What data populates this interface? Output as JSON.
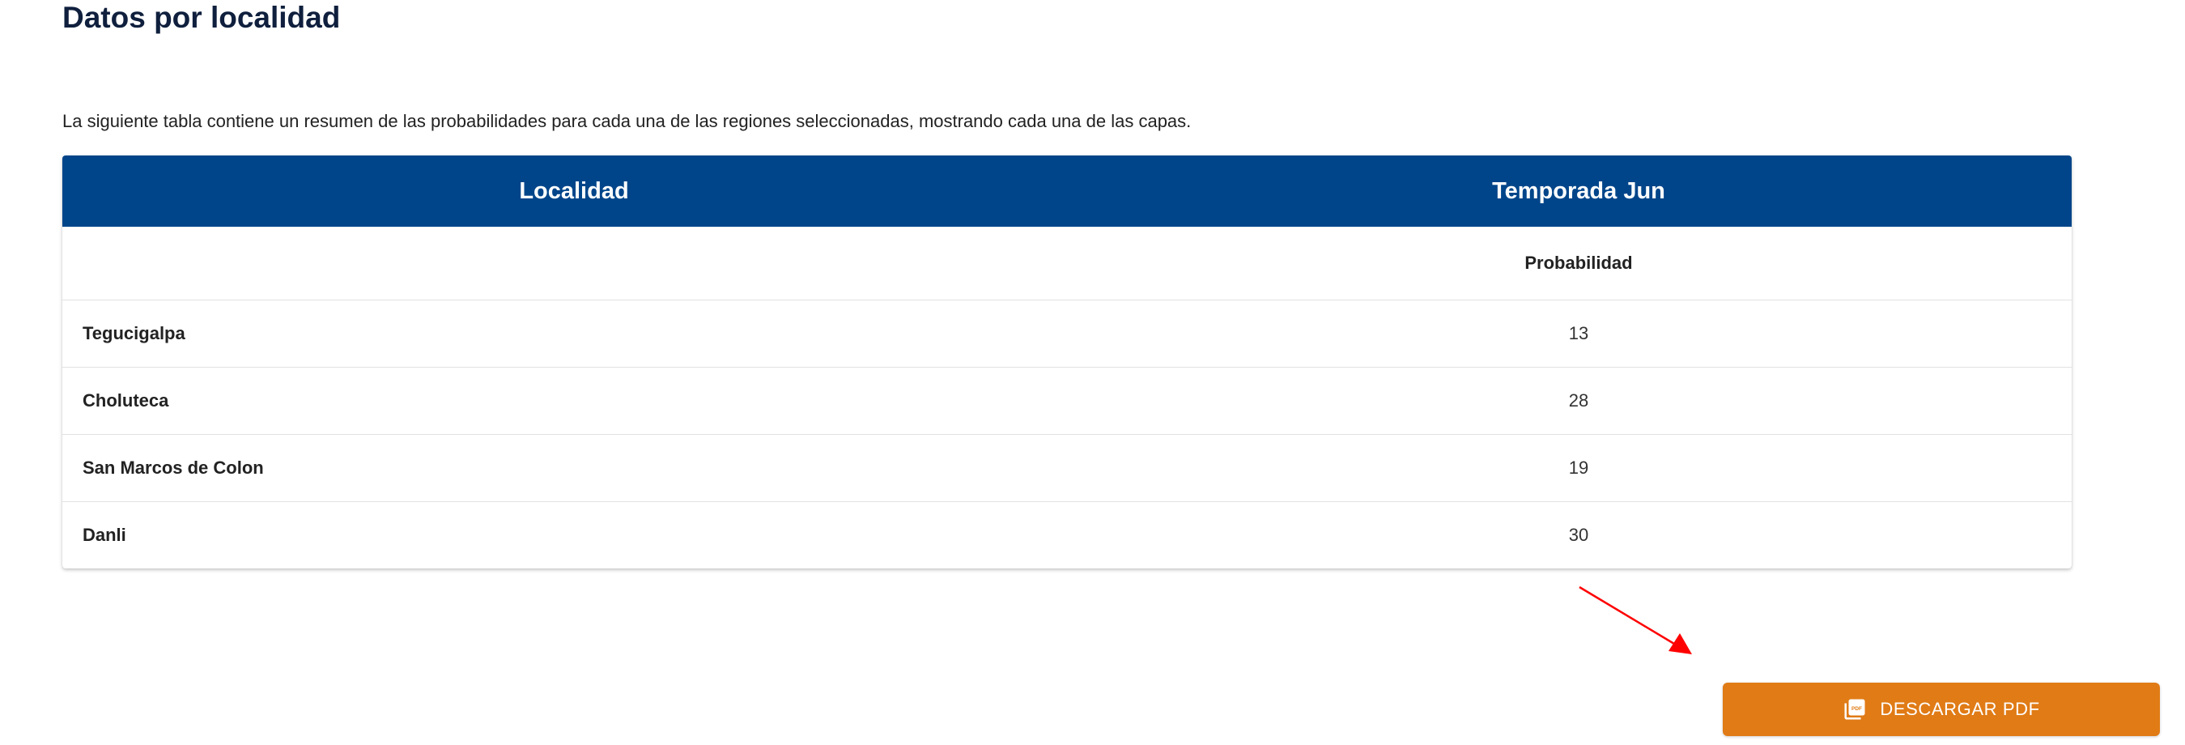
{
  "page": {
    "title": "Datos por localidad",
    "description": "La siguiente tabla contiene un resumen de las probabilidades para cada una de las regiones seleccionadas, mostrando cada una de las capas."
  },
  "table": {
    "columns": [
      "Localidad",
      "Temporada Jun"
    ],
    "subheader": [
      "",
      "Probabilidad"
    ],
    "rows": [
      {
        "localidad": "Tegucigalpa",
        "probabilidad": "13"
      },
      {
        "localidad": "Choluteca",
        "probabilidad": "28"
      },
      {
        "localidad": "San Marcos de Colon",
        "probabilidad": "19"
      },
      {
        "localidad": "Danli",
        "probabilidad": "30"
      }
    ]
  },
  "download": {
    "label": "DESCARGAR PDF",
    "icon": "pdf-file-icon"
  },
  "colors": {
    "header_bg": "#00458a",
    "title": "#0f1f3d",
    "button_bg": "#e07b16",
    "annotation_arrow": "#ff0000"
  }
}
